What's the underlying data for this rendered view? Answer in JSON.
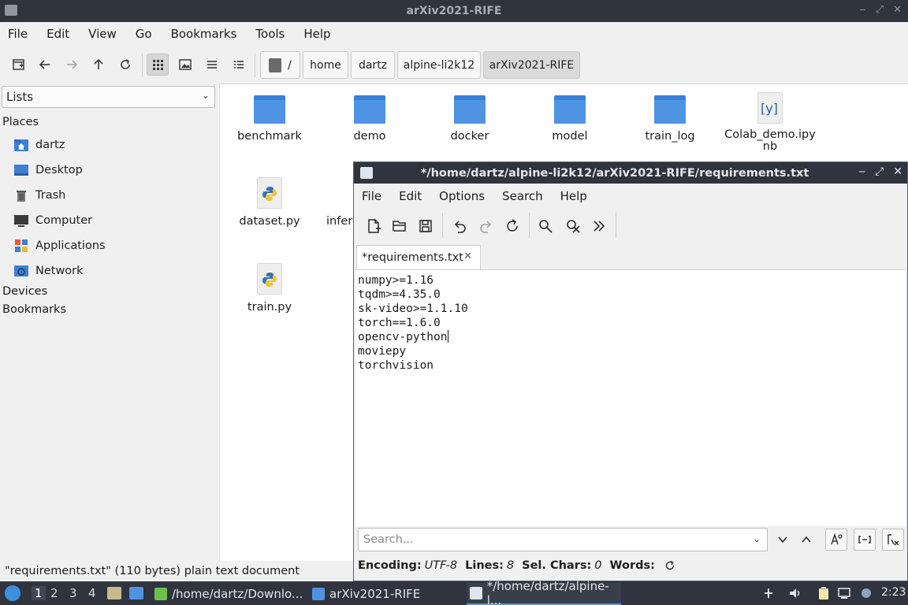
{
  "fm": {
    "title": "arXiv2021-RIFE",
    "menu": [
      "File",
      "Edit",
      "View",
      "Go",
      "Bookmarks",
      "Tools",
      "Help"
    ],
    "breadcrumbs": [
      "/",
      "home",
      "dartz",
      "alpine-li2k12",
      "arXiv2021-RIFE"
    ],
    "side_select": "Lists",
    "places_label": "Places",
    "places": [
      "dartz",
      "Desktop",
      "Trash",
      "Computer",
      "Applications",
      "Network"
    ],
    "devices_label": "Devices",
    "bookmarks_label": "Bookmarks",
    "items": {
      "benchmark": "benchmark",
      "demo": "demo",
      "docker": "docker",
      "model": "model",
      "train_log": "train_log",
      "colab_line1": "Colab_demo.ipy",
      "colab_line2": "nb",
      "colab_glyph": "[y]",
      "dataset": "dataset.py",
      "inference_partial": "infer",
      "train": "train.py"
    },
    "status": "\"requirements.txt\" (110 bytes) plain text document"
  },
  "editor": {
    "title": "*/home/dartz/alpine-li2k12/arXiv2021-RIFE/requirements.txt",
    "menu": [
      "File",
      "Edit",
      "Options",
      "Search",
      "Help"
    ],
    "tab_label": "*requirements.txt",
    "lines": [
      "numpy>=1.16",
      "tqdm>=4.35.0",
      "sk-video>=1.1.10",
      "torch==1.6.0",
      "opencv-python",
      "moviepy",
      "torchvision"
    ],
    "search_placeholder": "Search...",
    "status": {
      "encoding_label": "Encoding:",
      "encoding_value": "UTF-8",
      "lines_label": "Lines:",
      "lines_value": "8",
      "sel_label": "Sel. Chars:",
      "sel_value": "0",
      "words_label": "Words:"
    }
  },
  "taskbar": {
    "desktops": [
      "1",
      "2",
      "3",
      "4"
    ],
    "tasks": [
      "/home/dartz/Downlo...",
      "arXiv2021-RIFE",
      "*/home/dartz/alpine-l..."
    ],
    "clock": "2:23"
  },
  "colors": {
    "titlebar": "#2f343f",
    "folder": "#4f93e3",
    "accent": "#5294e2"
  }
}
